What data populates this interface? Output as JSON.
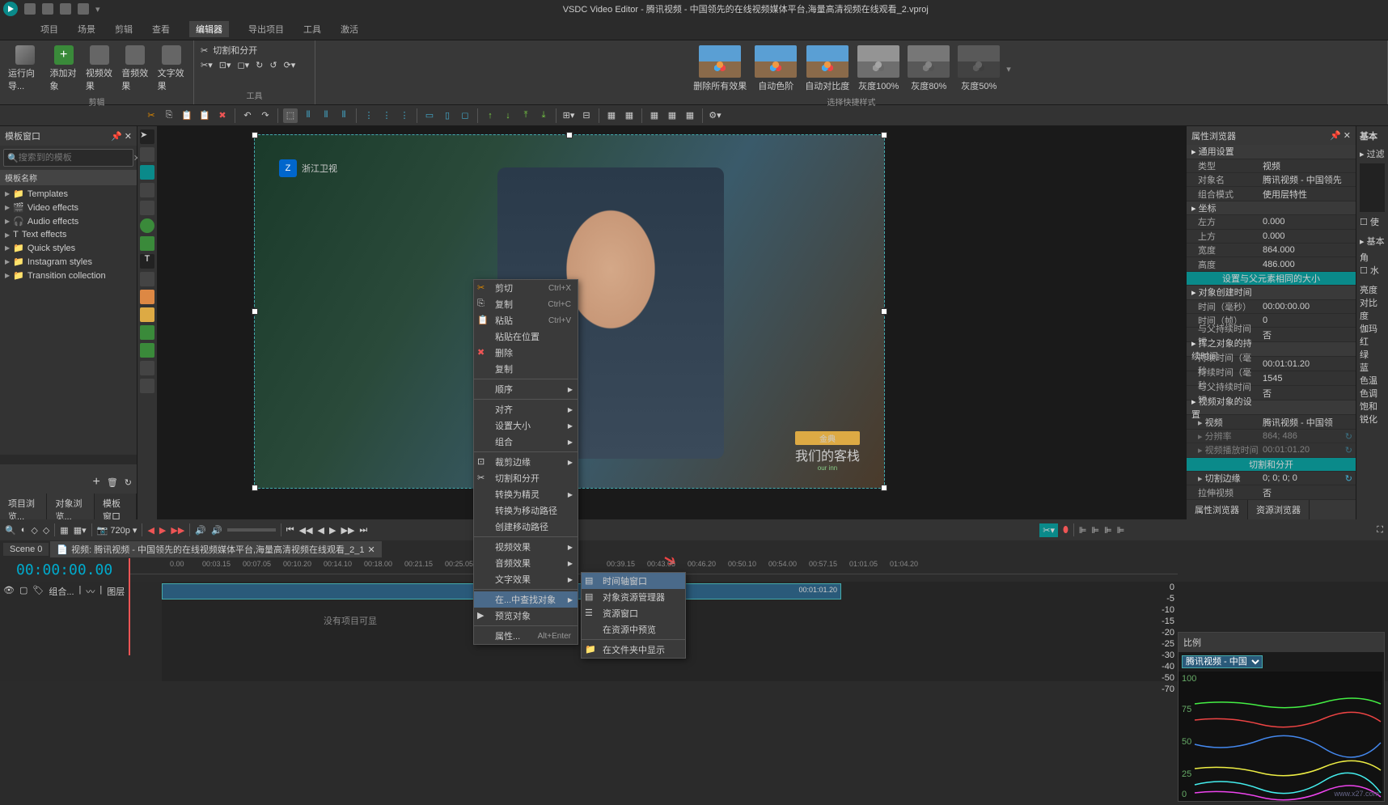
{
  "title": "VSDC Video Editor - 腾讯视频 - 中国领先的在线视频媒体平台,海量高清视频在线观看_2.vproj",
  "menu": {
    "project": "项目",
    "scene": "场景",
    "edit": "剪辑",
    "view": "查看",
    "editor": "编辑器",
    "export": "导出项目",
    "tools": "工具",
    "activate": "激活"
  },
  "ribbon": {
    "wizard": "运行向导...",
    "addobj": "添加对象",
    "videofx": "视频效果",
    "audiofx": "音频效果",
    "textfx": "文字效果",
    "cutsplit": "切割和分开",
    "editlbl": "剪辑",
    "toolslbl": "工具",
    "t1": "删除所有效果",
    "t2": "自动色阶",
    "t3": "自动对比度",
    "t4": "灰度100%",
    "t5": "灰度80%",
    "t6": "灰度50%",
    "stylelbl": "选择快捷样式"
  },
  "leftpanel": {
    "title": "模板窗口",
    "search_ph": "搜索到的模板",
    "colhead": "模板名称",
    "items": [
      "Templates",
      "Video effects",
      "Audio effects",
      "Text effects",
      "Quick styles",
      "Instagram styles",
      "Transition collection"
    ]
  },
  "ctx": {
    "cut": "剪切",
    "cut_sc": "Ctrl+X",
    "copy": "复制",
    "copy_sc": "Ctrl+C",
    "paste": "粘贴",
    "paste_sc": "Ctrl+V",
    "pasteat": "粘贴在位置",
    "delete": "删除",
    "dup": "复制",
    "order": "顺序",
    "align": "对齐",
    "size": "设置大小",
    "group": "组合",
    "crop": "裁剪边缘",
    "cutspl": "切割和分开",
    "sprite": "转换为精灵",
    "convmove": "转换为移动路径",
    "createmove": "创建移动路径",
    "vfx": "视频效果",
    "afx": "音频效果",
    "tfx": "文字效果",
    "find": "在...中查找对象",
    "preview": "预览对象",
    "props": "属性...",
    "props_sc": "Alt+Enter",
    "sub_timeline": "时间轴窗口",
    "sub_objres": "对象资源管理器",
    "sub_reswin": "资源窗口",
    "sub_prevres": "在资源中预览",
    "sub_folder": "在文件夹中显示"
  },
  "props": {
    "title": "属性浏览器",
    "basic": "基本",
    "filter": "过滤",
    "general": "通用设置",
    "type": "类型",
    "type_v": "视频",
    "objname": "对象名",
    "objname_v": "腾讯视频 - 中国领先",
    "blend": "组合模式",
    "blend_v": "使用层特性",
    "coord": "坐标",
    "left": "左方",
    "left_v": "0.000",
    "top": "上方",
    "top_v": "0.000",
    "width": "宽度",
    "width_v": "864.000",
    "height": "高度",
    "height_v": "486.000",
    "setparent": "设置与父元素相同的大小",
    "createtime": "对象创建时间",
    "time_ms": "时间（毫秒）",
    "time_ms_v": "00:00:00.00",
    "time_f": "时间（帧）",
    "time_f_v": "0",
    "lockp": "与父持续时间锁",
    "lockp_v": "否",
    "relduration": "挥之对象的持续时间",
    "dur_ms": "持续时间（毫秒",
    "dur_ms_v": "00:01:01.20",
    "dur_ms2": "持续时间（毫秒",
    "dur_ms2_v": "1545",
    "lockp2": "与父持续时间锁",
    "lockp2_v": "否",
    "videoobj": "视频对象的设置",
    "video": "视频",
    "video_v": "腾讯视频 - 中国领",
    "res": "分辨率",
    "res_v": "864; 486",
    "viddur": "视频播放时间",
    "viddur_v": "00:01:01.20",
    "cutspl": "切割和分开",
    "cropedge": "切割边缘",
    "cropedge_v": "0; 0; 0; 0",
    "stretch": "拉伸视频",
    "stretch_v": "否"
  },
  "propstabs": {
    "prop": "属性浏览器",
    "res": "资源浏览器"
  },
  "basicside": {
    "filter": "过滤",
    "use": "使",
    "basic": "基本",
    "angle": "角",
    "horiz": "水",
    "bright": "亮度",
    "contrast": "对比度",
    "gamma": "伽玛",
    "red": "红",
    "green": "绿",
    "blue": "蓝",
    "temp": "色温",
    "tint": "色调",
    "sat": "饱和",
    "sharp": "锐化"
  },
  "bottomtabs": {
    "projbrowse": "项目浏览...",
    "objbrowse": "对象浏览...",
    "tplwin": "模板窗口"
  },
  "timeline": {
    "res": "720p",
    "scene": "Scene 0",
    "tab": "视频: 腾讯视频 - 中国领先的在线视频媒体平台,海量高清视频在线观看_2_1",
    "bigtime": "00:00:00.00",
    "noitems": "没有项目可显",
    "group": "组合...",
    "layer": "图层",
    "ticks": [
      "0.00",
      "00:03.15",
      "00:07.05",
      "00:10.20",
      "00:14.10",
      "00:18.00",
      "00:21.15",
      "00:25.05",
      "00:39.15",
      "00:43.05",
      "00:46.20",
      "00:50.10",
      "00:54.00",
      "00:57.15",
      "01:01.05",
      "01:04.20"
    ],
    "endtime": "00:01:01.20"
  },
  "scopes": {
    "title": "比例",
    "source": "腾讯视频 - 中国"
  },
  "watermark": "www.x27.com"
}
